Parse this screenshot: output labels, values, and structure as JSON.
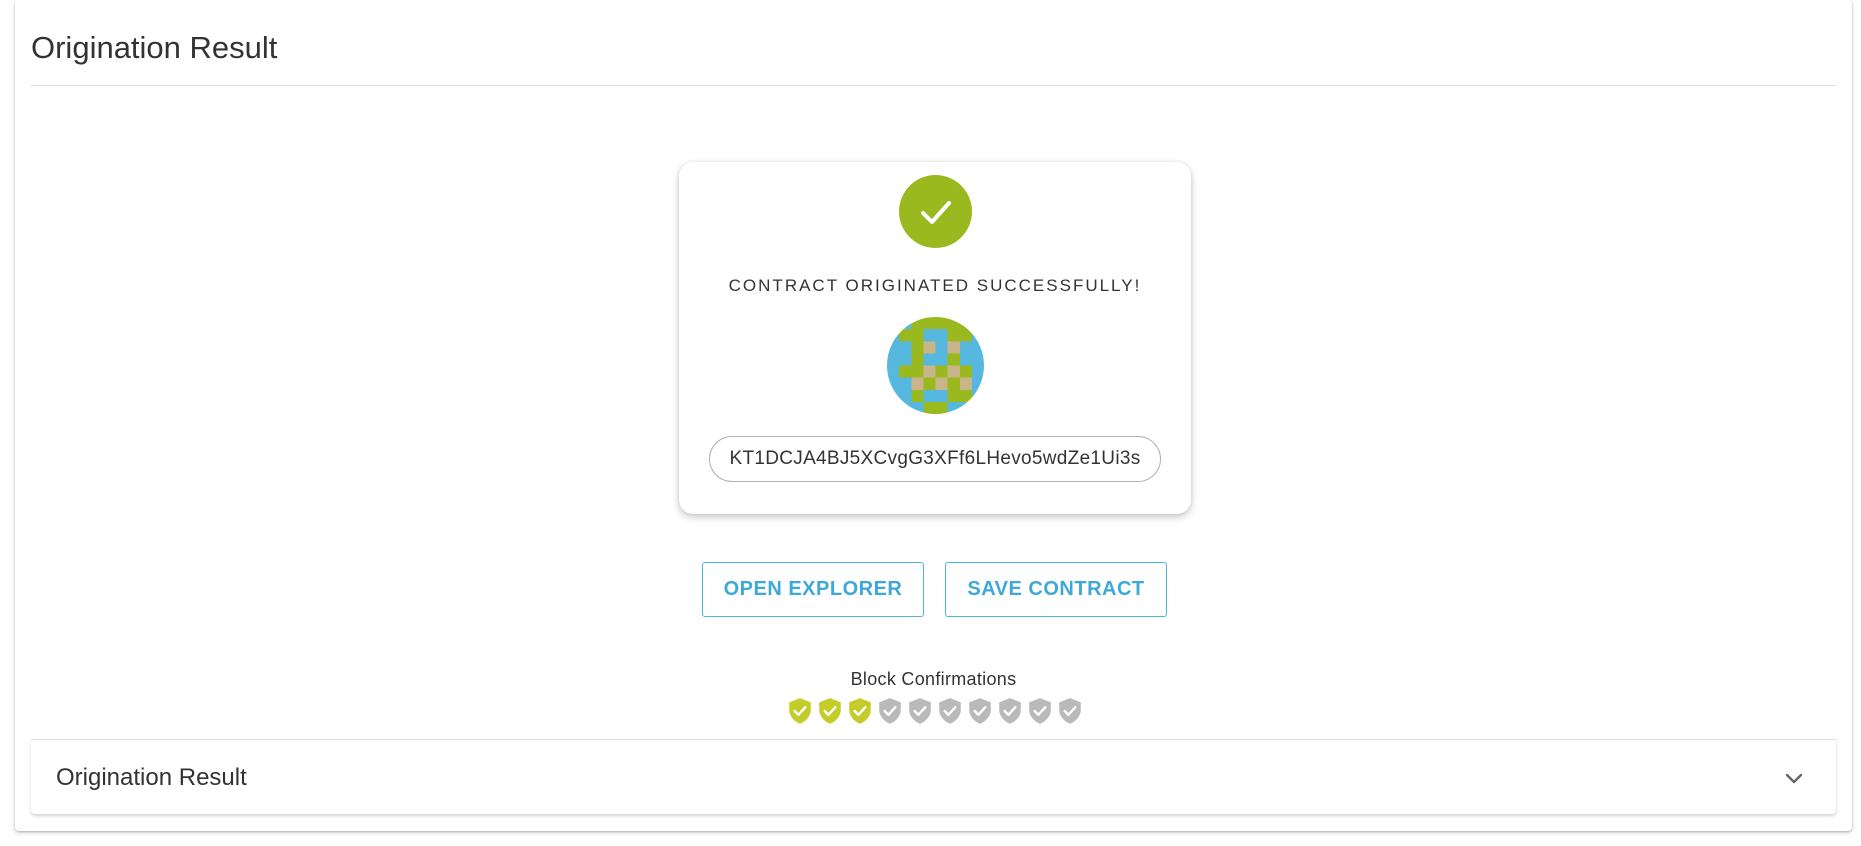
{
  "panel": {
    "title": "Origination Result"
  },
  "result_card": {
    "success_icon": "check-circle-icon",
    "success_message": "CONTRACT ORIGINATED SUCCESSFULLY!",
    "avatar_icon": "identicon-avatar",
    "contract_address": "KT1DCJA4BJ5XCvgG3XFf6LHevo5wdZe1Ui3s"
  },
  "actions": {
    "open_explorer_label": "OPEN EXPLORER",
    "save_contract_label": "SAVE CONTRACT"
  },
  "confirmations": {
    "label": "Block Confirmations",
    "confirmed": 3,
    "total": 10,
    "icon": "shield-check-icon"
  },
  "accordion": {
    "title": "Origination Result",
    "expand_icon": "chevron-down-icon"
  },
  "colors": {
    "success_green": "#9ab91f",
    "confirmed_shield": "#c4cc2a",
    "pending_shield": "#b9b9b9",
    "accent_blue": "#3ea8d8",
    "avatar_blue": "#56b8df",
    "avatar_green": "#9ab91f",
    "avatar_tan": "#c9b58a"
  }
}
